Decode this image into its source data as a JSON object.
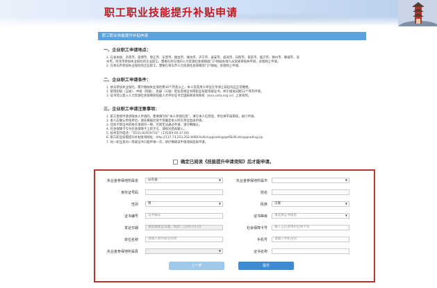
{
  "header": {
    "title": "职工职业技能提升补贴申请"
  },
  "breadcrumb": "职工职业技能提升补贴申请",
  "notice": {
    "sec1_title": "一、企业职工申请地点：",
    "sec1_lines": [
      "1. 在省本级、济南市、淄博市、枣庄市、东营市、烟台市、潍坊市、济宁市、泰安市、威海市、日照市、莱芜市、临沂市、德州市、聊城市、滨",
      "州市、菏泽市参加失业保险的企业职工，需要在所在地的人力资源社会保障部门户网站办理人员资质审核并申请，办理网上申请。",
      "2. 在青岛市参加失业保险的企业职工，需要在青岛市人力资源社会保障部门户网站，办理网上申请。"
    ],
    "sec2_title": "二、企业职工申请条件：",
    "sec2_lines": [
      "1. 依法参加失业保险，累计缴纳失业保险费36个月及以上，本人及其用人单位在申请之日起均应正常缴费。",
      "2. 取得初级（五级）、中级（四级）、高级（三级）职业资格证书或职业技能等级证书，并于颁发日期12个月内申请。",
      "3. 证书可以登入人力资源社会保障部技能人才评价证书全国联网查询系统（zscx.osta.org.cn）上查询到。"
    ],
    "sec3_title": "三、企业职工申请注意事项：",
    "sec3_lines": [
      "1. 职工直接申请领取本人申请的，需要填写好“本人参保信息”，填写本人信息后，单位将不再审核，再行申请。",
      "2. 本人应确认参保单位，请先根据社保卡等确定本人所在单位后再申请。",
      "3. 社保卡和证书的姓名须保持一致，否则无法通过申请，请仔细确认。",
      "4. 社会保障卡号为社会保障卡上的卡号，请核对后再输入。",
      "5. 技术支持电话：“0531-81919733”（工作日9:00-17:00）",
      "6. 职工职业技能提升补贴查询网址：http://117.73.253.202:8080/skills/upgrading/getSkillList/upgrading.jsp",
      "7. 同一职业及同一等级证书只能申请一次，请仔细阅读申请须知后再申请。"
    ]
  },
  "confirm_text": "确定已阅读《技能提升申请须知》后才能申请。",
  "form": {
    "left": [
      {
        "label": "失业金参保地所属省",
        "value": "山东省",
        "type": "select"
      },
      {
        "label": "身份证号码",
        "value": "",
        "type": "input"
      },
      {
        "label": "性别",
        "value": "男",
        "type": "select"
      },
      {
        "label": "证书编号",
        "value": "证书编号",
        "type": "input"
      },
      {
        "label": "发证日期",
        "value": "请选择发证日期，格式：2000-01-01",
        "type": "input"
      },
      {
        "label": "单位名称",
        "value": "请输入你的单位名称",
        "type": "input"
      },
      {
        "label": "失业金参保地所属县",
        "value": "",
        "type": "select"
      }
    ],
    "right": [
      {
        "label": "失业金参保地所属市",
        "value": "",
        "type": "select"
      },
      {
        "label": "姓名",
        "value": "",
        "type": "input"
      },
      {
        "label": "民族",
        "value": "汉族",
        "type": "select"
      },
      {
        "label": "证书等级",
        "value": "请选择证书级别",
        "type": "select"
      },
      {
        "label": "社会保障卡号",
        "value": "输入正在使用的社保卡号",
        "type": "input"
      },
      {
        "label": "手机号",
        "value": "请输入手机号码",
        "type": "input"
      },
      {
        "label": "证书名称",
        "value": "",
        "type": "input"
      }
    ],
    "prev_label": "上一步",
    "next_label": "提交"
  },
  "colors": {
    "title_red": "#c8161d",
    "bar_blue": "#5aa3dc",
    "border_red": "#c0302c",
    "btn_blue": "#3d8bd3"
  }
}
